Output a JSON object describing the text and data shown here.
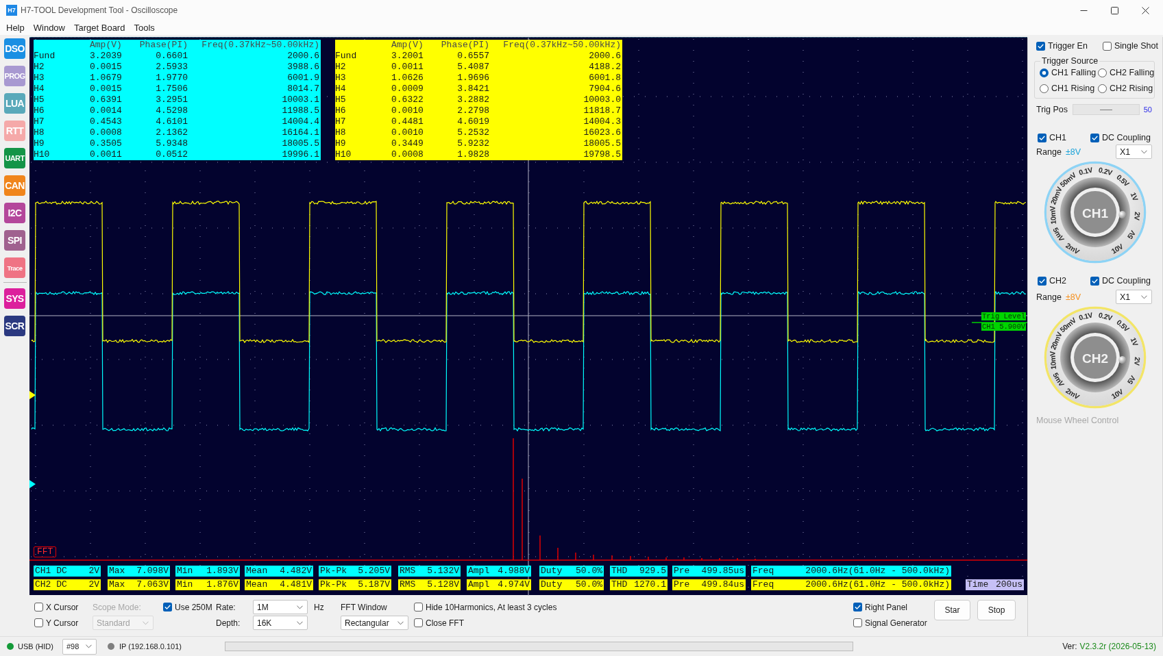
{
  "window": {
    "app_icon": "H7",
    "title": "H7-TOOL Development Tool - Oscilloscope"
  },
  "menu": [
    "Help",
    "Window",
    "Target Board",
    "Tools"
  ],
  "sidebar": {
    "sections": [
      {
        "items": [
          {
            "label": "DSO",
            "color": "#1a8fe3"
          },
          {
            "label": "PROG",
            "color": "#a899d1"
          },
          {
            "label": "LUA",
            "color": "#5aa9ba"
          },
          {
            "label": "RTT",
            "color": "#f5a9a9"
          },
          {
            "label": "UART",
            "color": "#149447"
          },
          {
            "label": "CAN",
            "color": "#f0851c"
          },
          {
            "label": "I2C",
            "color": "#b4479b"
          },
          {
            "label": "SPI",
            "color": "#a0618f"
          },
          {
            "label": "Trace",
            "color": "#ef7384"
          }
        ]
      },
      {
        "items": [
          {
            "label": "SYS",
            "color": "#dc1f9c"
          },
          {
            "label": "SCR",
            "color": "#2b3980"
          }
        ]
      }
    ]
  },
  "scope": {
    "harmonic_tables": [
      {
        "color": "#00ffff",
        "columns": [
          "Amp(V)",
          "Phase(PI)",
          "Freq(0.37kHz~50.00kHz)"
        ],
        "rows": [
          {
            "harmonic": "Fund",
            "cells": [
              "3.2039",
              "0.6601",
              "2000.6"
            ]
          },
          {
            "harmonic": "H2",
            "cells": [
              "0.0015",
              "2.5933",
              "3988.6"
            ]
          },
          {
            "harmonic": "H3",
            "cells": [
              "1.0679",
              "1.9770",
              "6001.9"
            ]
          },
          {
            "harmonic": "H4",
            "cells": [
              "0.0015",
              "1.7506",
              "8014.7"
            ]
          },
          {
            "harmonic": "H5",
            "cells": [
              "0.6391",
              "3.2951",
              "10003.1"
            ]
          },
          {
            "harmonic": "H6",
            "cells": [
              "0.0014",
              "4.5298",
              "11988.5"
            ]
          },
          {
            "harmonic": "H7",
            "cells": [
              "0.4543",
              "4.6101",
              "14004.4"
            ]
          },
          {
            "harmonic": "H8",
            "cells": [
              "0.0008",
              "2.1362",
              "16164.1"
            ]
          },
          {
            "harmonic": "H9",
            "cells": [
              "0.3505",
              "5.9348",
              "18005.5"
            ]
          },
          {
            "harmonic": "H10",
            "cells": [
              "0.0011",
              "0.0512",
              "19996.1"
            ]
          }
        ]
      },
      {
        "color": "#ffff00",
        "columns": [
          "Amp(V)",
          "Phase(PI)",
          "Freq(0.37kHz~50.00kHz)"
        ],
        "rows": [
          {
            "harmonic": "Fund",
            "cells": [
              "3.2001",
              "0.6557",
              "2000.6"
            ]
          },
          {
            "harmonic": "H2",
            "cells": [
              "0.0011",
              "5.4087",
              "4188.2"
            ]
          },
          {
            "harmonic": "H3",
            "cells": [
              "1.0626",
              "1.9696",
              "6001.8"
            ]
          },
          {
            "harmonic": "H4",
            "cells": [
              "0.0009",
              "3.8421",
              "7904.6"
            ]
          },
          {
            "harmonic": "H5",
            "cells": [
              "0.6322",
              "3.2882",
              "10003.0"
            ]
          },
          {
            "harmonic": "H6",
            "cells": [
              "0.0010",
              "2.2798",
              "11818.7"
            ]
          },
          {
            "harmonic": "H7",
            "cells": [
              "0.4481",
              "4.6019",
              "14004.3"
            ]
          },
          {
            "harmonic": "H8",
            "cells": [
              "0.0010",
              "5.2532",
              "16023.6"
            ]
          },
          {
            "harmonic": "H9",
            "cells": [
              "0.3449",
              "5.9232",
              "18005.5"
            ]
          },
          {
            "harmonic": "H10",
            "cells": [
              "0.0008",
              "1.9828",
              "19798.5"
            ]
          }
        ]
      }
    ],
    "trigger_marker": {
      "label": "Trig Level",
      "value": "CH1 5.900V"
    },
    "fft_label": "FFT",
    "measurement_rows": [
      {
        "color": "#00ffff",
        "cells": [
          {
            "label": "CH1 DC",
            "value": "2V"
          },
          {
            "label": "Max",
            "value": "7.098V"
          },
          {
            "label": "Min",
            "value": "1.893V"
          },
          {
            "label": "Mean",
            "value": "4.482V"
          },
          {
            "label": "Pk-Pk",
            "value": "5.205V"
          },
          {
            "label": "RMS",
            "value": "5.132V"
          },
          {
            "label": "Ampl",
            "value": "4.988V"
          },
          {
            "label": "Duty",
            "value": "50.0%"
          },
          {
            "label": "THD",
            "value": "929.5"
          },
          {
            "label": "Pre",
            "value": "499.85us"
          },
          {
            "label": "Freq",
            "value": "2000.6Hz(61.0Hz - 500.0kHz)"
          }
        ]
      },
      {
        "color": "#ffff00",
        "cells": [
          {
            "label": "CH2 DC",
            "value": "2V"
          },
          {
            "label": "Max",
            "value": "7.063V"
          },
          {
            "label": "Min",
            "value": "1.876V"
          },
          {
            "label": "Mean",
            "value": "4.481V"
          },
          {
            "label": "Pk-Pk",
            "value": "5.187V"
          },
          {
            "label": "RMS",
            "value": "5.128V"
          },
          {
            "label": "Ampl",
            "value": "4.974V"
          },
          {
            "label": "Duty",
            "value": "50.0%"
          },
          {
            "label": "THD",
            "value": "1270.1"
          },
          {
            "label": "Pre",
            "value": "499.84us"
          },
          {
            "label": "Freq",
            "value": "2000.6Hz(61.0Hz - 500.0kHz)"
          }
        ]
      }
    ],
    "timebase": {
      "label": "Time",
      "value": "200us"
    }
  },
  "right_panel": {
    "trigger_enable": {
      "label": "Trigger En",
      "checked": true
    },
    "single_shot": {
      "label": "Single Shot",
      "checked": false
    },
    "trigger_source": {
      "title": "Trigger Source",
      "options": [
        {
          "label": "CH1 Falling",
          "selected": true
        },
        {
          "label": "CH2 Falling",
          "selected": false
        },
        {
          "label": "CH1 Rising",
          "selected": false
        },
        {
          "label": "CH2 Rising",
          "selected": false
        }
      ]
    },
    "trig_pos": {
      "label": "Trig Pos",
      "level": 0.5,
      "value": "50"
    },
    "channels": [
      {
        "enable": {
          "label": "CH1",
          "checked": true
        },
        "coupling": {
          "label": "DC Coupling",
          "checked": true
        },
        "range_label": "Range",
        "range_value": "±8V",
        "color": "#1aa3d9",
        "probe": "X1",
        "knob": {
          "label": "CH1",
          "color": "#8dd3f5",
          "scale": [
            {
              "text": "2mV",
              "selected": false
            },
            {
              "text": "5mV",
              "selected": false
            },
            {
              "text": "10mV",
              "selected": false
            },
            {
              "text": "20mV",
              "selected": false
            },
            {
              "text": "50mV",
              "selected": false
            },
            {
              "text": "0.1V",
              "selected": false
            },
            {
              "text": "0.2V",
              "selected": false
            },
            {
              "text": "0.5V",
              "selected": false
            },
            {
              "text": "1V",
              "selected": false
            },
            {
              "text": "2V",
              "selected": true
            },
            {
              "text": "5V",
              "selected": false
            },
            {
              "text": "10V",
              "selected": false
            }
          ]
        }
      },
      {
        "enable": {
          "label": "CH2",
          "checked": true
        },
        "coupling": {
          "label": "DC Coupling",
          "checked": true
        },
        "range_label": "Range",
        "range_value": "±8V",
        "color": "#f5901e",
        "probe": "X1",
        "knob": {
          "label": "CH2",
          "color": "#f3e567",
          "scale": [
            {
              "text": "2mV",
              "selected": false
            },
            {
              "text": "5mV",
              "selected": false
            },
            {
              "text": "10mV",
              "selected": false
            },
            {
              "text": "20mV",
              "selected": false
            },
            {
              "text": "50mV",
              "selected": false
            },
            {
              "text": "0.1V",
              "selected": false
            },
            {
              "text": "0.2V",
              "selected": false
            },
            {
              "text": "0.5V",
              "selected": false
            },
            {
              "text": "1V",
              "selected": false
            },
            {
              "text": "2V",
              "selected": true
            },
            {
              "text": "5V",
              "selected": false
            },
            {
              "text": "10V",
              "selected": false
            }
          ]
        }
      }
    ],
    "hint": "Mouse Wheel Control"
  },
  "controls": {
    "x_cursor": {
      "label": "X Cursor",
      "checked": false
    },
    "y_cursor": {
      "label": "Y Cursor",
      "checked": false
    },
    "scope_mode": {
      "label": "Scope Mode:",
      "value": "Standard",
      "disabled": true
    },
    "use_250m": {
      "label": "Use 250M",
      "checked": true
    },
    "rate": {
      "label": "Rate:",
      "value": "1M",
      "unit": "Hz"
    },
    "depth": {
      "label": "Depth:",
      "value": "16K"
    },
    "fft_window": {
      "label": "FFT Window",
      "value": "Rectangular"
    },
    "hide_harmonics": {
      "label": "Hide 10Harmonics, At least 3 cycles",
      "checked": false
    },
    "close_fft": {
      "label": "Close FFT",
      "checked": false
    },
    "right_panel": {
      "label": "Right Panel",
      "checked": true
    },
    "signal_generator": {
      "label": "Signal Generator",
      "checked": false
    },
    "buttons": [
      "Star",
      "Stop"
    ]
  },
  "status_bar": {
    "usb": {
      "label": "USB (HID)",
      "connected": true
    },
    "device": "#98",
    "ip": {
      "label": "IP (192.168.0.101)",
      "connected": false
    },
    "version_label": "Ver:",
    "version": "V2.3.2r (2026-05-13)"
  }
}
